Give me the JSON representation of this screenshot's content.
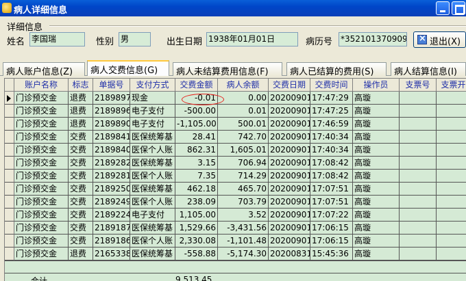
{
  "window": {
    "title": "病人详细信息"
  },
  "details": {
    "group_label": "详细信息",
    "name_label": "姓名",
    "name_value": "李国瑞",
    "gender_label": "性别",
    "gender_value": "男",
    "birth_label": "出生日期",
    "birth_value": "1938年01月01日",
    "record_label": "病历号",
    "record_value": "*352101370909"
  },
  "exit_button": {
    "label": "退出(X)"
  },
  "tabs": [
    {
      "label": "病人账户信息(Z)"
    },
    {
      "label": "病人交费信息(G)"
    },
    {
      "label": "病人未结算费用信息(F)"
    },
    {
      "label": "病人已结算的费用(S)"
    },
    {
      "label": "病人结算信息(I)"
    }
  ],
  "grid": {
    "columns": [
      "账户名称",
      "标志",
      "单据号",
      "支付方式",
      "交费金额",
      "病人余额",
      "交费日期",
      "交费时间",
      "操作员",
      "支票号",
      "支票开"
    ],
    "rows": [
      [
        "门诊预交金",
        "退费",
        "2189897",
        "现金",
        "-0.01",
        "0.00",
        "20200901",
        "17:47:29",
        "高璇",
        "",
        ""
      ],
      [
        "门诊预交金",
        "退费",
        "2189896",
        "电子支付",
        "-500.00",
        "0.01",
        "20200901",
        "17:47:25",
        "高璇",
        "",
        ""
      ],
      [
        "门诊预交金",
        "退费",
        "2189890",
        "电子支付",
        "-1,105.00",
        "500.01",
        "20200901",
        "17:46:59",
        "高璇",
        "",
        ""
      ],
      [
        "门诊预交金",
        "交费",
        "2189841",
        "医保统筹基",
        "28.41",
        "742.70",
        "20200901",
        "17:40:34",
        "高璇",
        "",
        ""
      ],
      [
        "门诊预交金",
        "交费",
        "2189840",
        "医保个人账",
        "862.31",
        "1,605.01",
        "20200901",
        "17:40:34",
        "高璇",
        "",
        ""
      ],
      [
        "门诊预交金",
        "交费",
        "2189282",
        "医保统筹基",
        "3.15",
        "706.94",
        "20200901",
        "17:08:42",
        "高璇",
        "",
        ""
      ],
      [
        "门诊预交金",
        "交费",
        "2189281",
        "医保个人账",
        "7.35",
        "714.29",
        "20200901",
        "17:08:42",
        "高璇",
        "",
        ""
      ],
      [
        "门诊预交金",
        "交费",
        "2189250",
        "医保统筹基",
        "462.18",
        "465.70",
        "20200901",
        "17:07:51",
        "高璇",
        "",
        ""
      ],
      [
        "门诊预交金",
        "交费",
        "2189249",
        "医保个人账",
        "238.09",
        "703.79",
        "20200901",
        "17:07:51",
        "高璇",
        "",
        ""
      ],
      [
        "门诊预交金",
        "交费",
        "2189224",
        "电子支付",
        "1,105.00",
        "3.52",
        "20200901",
        "17:07:22",
        "高璇",
        "",
        ""
      ],
      [
        "门诊预交金",
        "交费",
        "2189187",
        "医保统筹基",
        "1,529.66",
        "-3,431.56",
        "20200901",
        "17:06:15",
        "高璇",
        "",
        ""
      ],
      [
        "门诊预交金",
        "交费",
        "2189186",
        "医保个人账",
        "2,330.08",
        "-1,101.48",
        "20200901",
        "17:06:15",
        "高璇",
        "",
        ""
      ],
      [
        "门诊预交金",
        "退费",
        "2165338",
        "医保统筹基",
        "-558.88",
        "-5,174.30",
        "20200831",
        "15:45:36",
        "高璇",
        "",
        ""
      ]
    ],
    "total_label": "合计",
    "total_value": "9,513.45"
  }
}
